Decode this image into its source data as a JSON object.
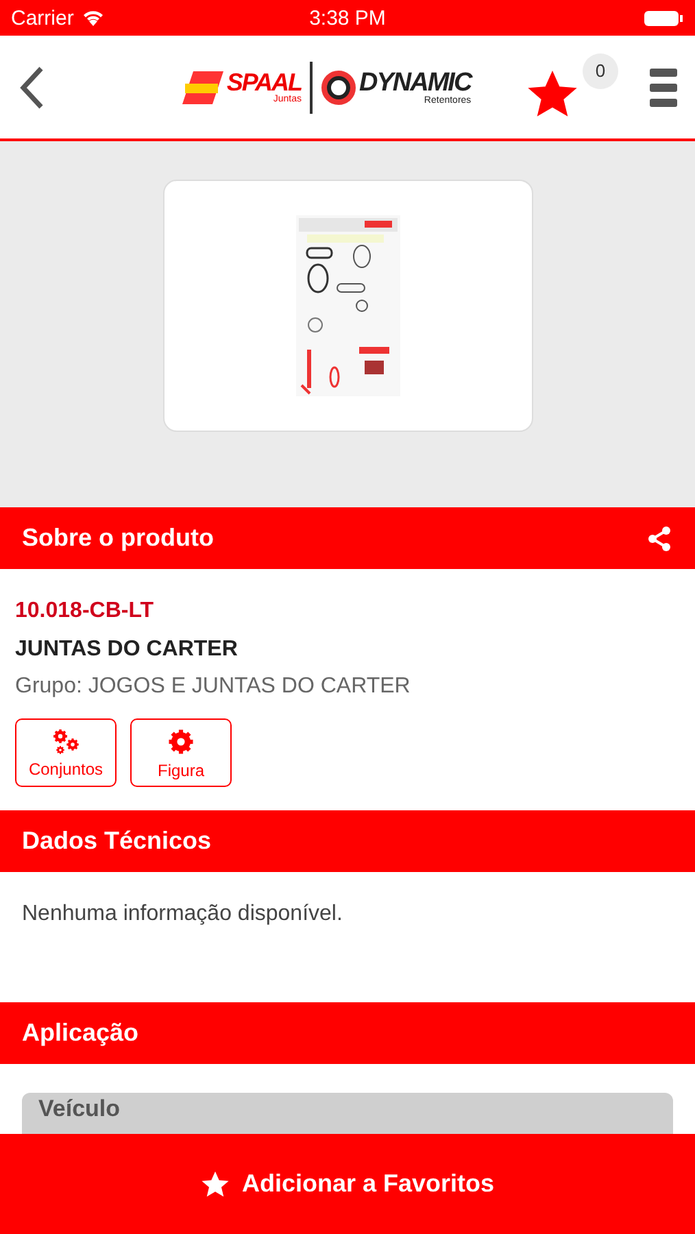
{
  "status_bar": {
    "carrier": "Carrier",
    "time": "3:38 PM"
  },
  "header": {
    "logo_left": {
      "name": "SPAAL",
      "sub": "Juntas"
    },
    "logo_right": {
      "name": "DYNAMIC",
      "sub": "Retentores"
    },
    "favorites_count": "0"
  },
  "sections": [
    {
      "kind": "product",
      "title": "Sobre o produto",
      "share": true,
      "code": "10.018-CB-LT",
      "name": "JUNTAS DO CARTER",
      "group": "Grupo: JOGOS E JUNTAS DO CARTER",
      "actions": [
        {
          "label": "Conjuntos",
          "kind": "gears"
        },
        {
          "label": "Figura",
          "kind": "gear"
        }
      ]
    },
    {
      "kind": "text",
      "title": "Dados Técnicos",
      "share": false,
      "text": "Nenhuma informação disponível."
    },
    {
      "kind": "table",
      "title": "Aplicação",
      "share": false,
      "column": "Veículo"
    }
  ],
  "bottom_button": {
    "label": "Adicionar a Favoritos"
  }
}
